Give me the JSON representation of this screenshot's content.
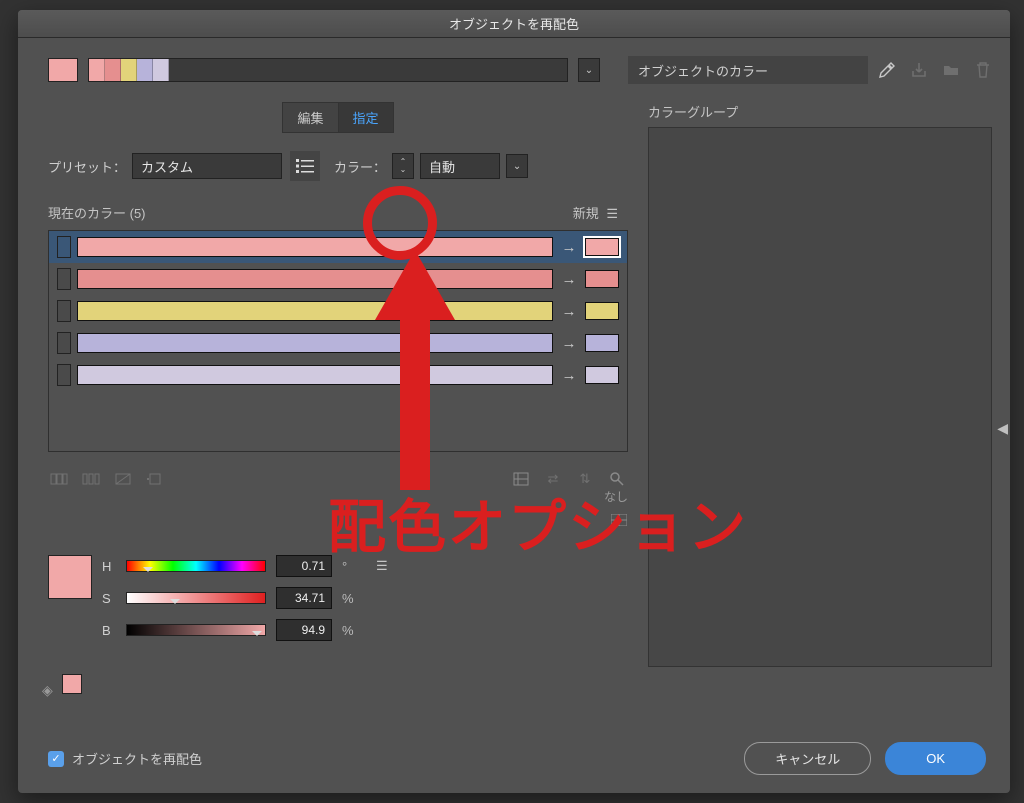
{
  "title": "オブジェクトを再配色",
  "object_colors_label": "オブジェクトのカラー",
  "color_groups_label": "カラーグループ",
  "tabs": {
    "edit": "編集",
    "assign": "指定"
  },
  "preset_label": "プリセット：",
  "preset_value": "カスタム",
  "colors_label": "カラー：",
  "colors_value": "自動",
  "current_colors_label": "現在のカラー (5)",
  "new_label": "新規",
  "rows": [
    {
      "hex": "#f1a8a8",
      "selected": true
    },
    {
      "hex": "#e58f8f",
      "selected": false
    },
    {
      "hex": "#e2d37a",
      "selected": false
    },
    {
      "hex": "#b7b3da",
      "selected": false
    },
    {
      "hex": "#d0c9df",
      "selected": false
    }
  ],
  "swatches": [
    "#f1a8a8",
    "#e58f8f",
    "#e2d37a",
    "#b7b3da",
    "#d0c9df"
  ],
  "hsb": {
    "h_label": "H",
    "h_value": "0.71",
    "h_unit": "°",
    "s_label": "S",
    "s_value": "34.71",
    "s_unit": "%",
    "b_label": "B",
    "b_value": "94.9",
    "b_unit": "%"
  },
  "status_none": "なし",
  "recolor_checkbox": "オブジェクトを再配色",
  "buttons": {
    "cancel": "キャンセル",
    "ok": "OK"
  },
  "annotation_text": "配色オプション"
}
